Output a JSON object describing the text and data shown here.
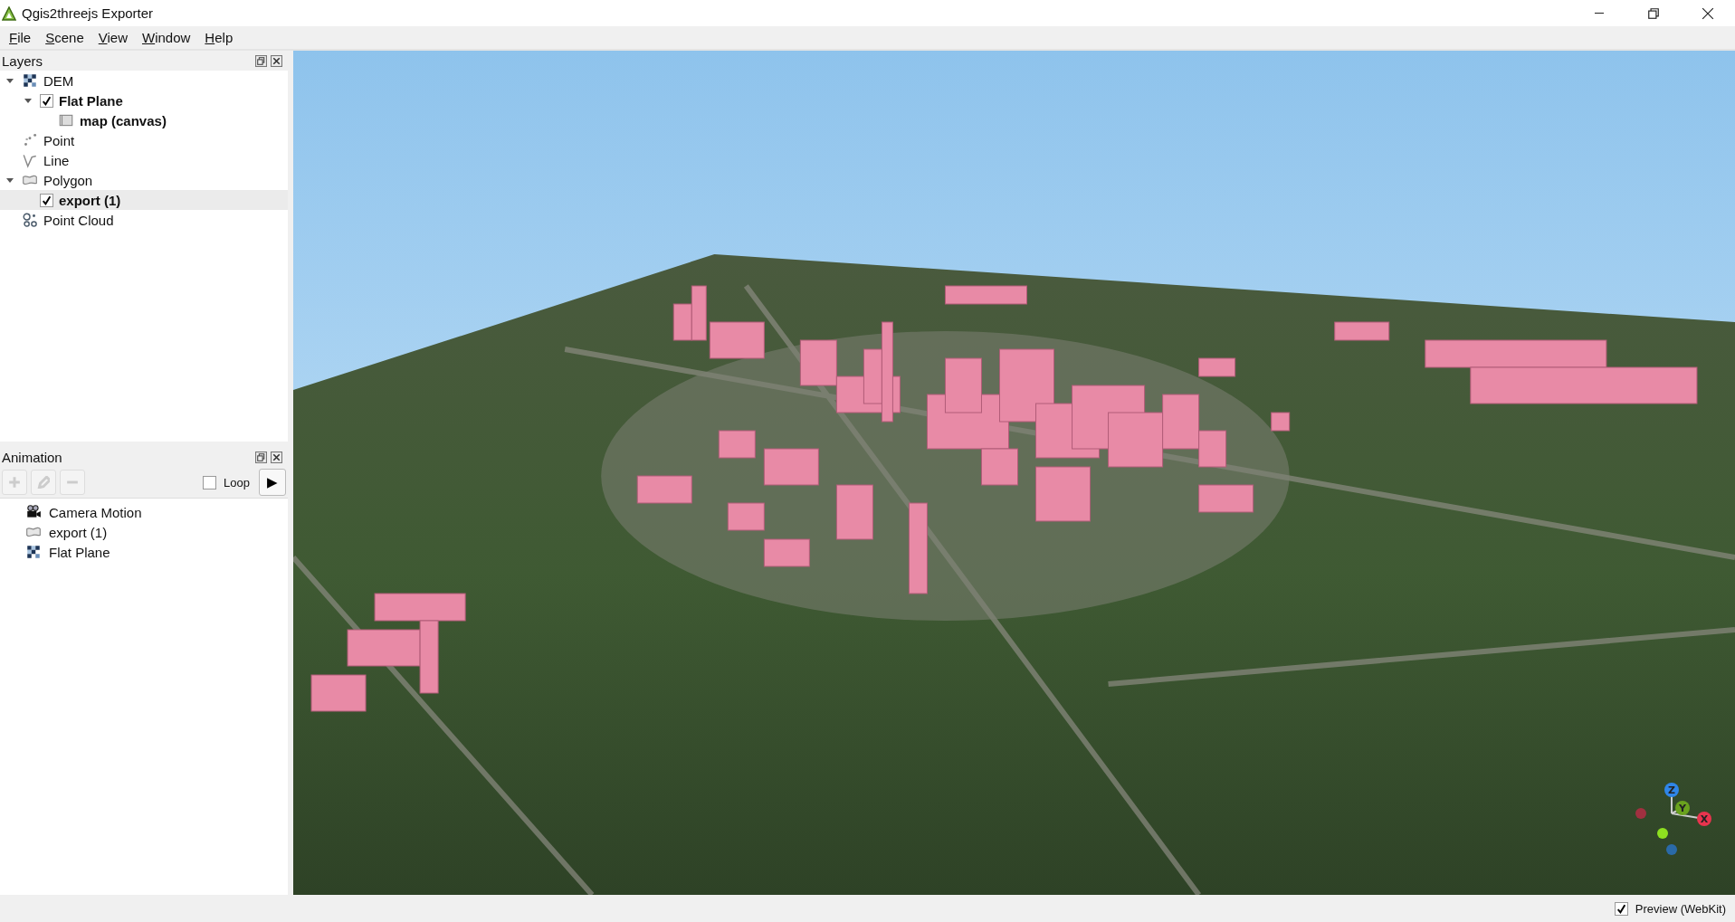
{
  "window": {
    "title": "Qgis2threejs Exporter"
  },
  "menu": [
    "File",
    "Scene",
    "View",
    "Window",
    "Help"
  ],
  "layers_panel": {
    "title": "Layers",
    "items": [
      {
        "label": "DEM",
        "kind": "dem",
        "bold": false,
        "selected": false,
        "expanded": true,
        "children": [
          {
            "label": "Flat Plane",
            "checked": true,
            "bold": true,
            "selected": false,
            "expanded": true,
            "children": [
              {
                "label": "map (canvas)",
                "kind": "map",
                "bold": true,
                "selected": false
              }
            ]
          }
        ]
      },
      {
        "label": "Point",
        "kind": "point",
        "bold": false,
        "selected": false
      },
      {
        "label": "Line",
        "kind": "line",
        "bold": false,
        "selected": false
      },
      {
        "label": "Polygon",
        "kind": "polygon",
        "bold": false,
        "selected": false,
        "expanded": true,
        "children": [
          {
            "label": "export (1)",
            "checked": true,
            "bold": true,
            "selected": true
          }
        ]
      },
      {
        "label": "Point Cloud",
        "kind": "pointcloud",
        "bold": false,
        "selected": false
      }
    ]
  },
  "animation_panel": {
    "title": "Animation",
    "tools": [
      {
        "kind": "add",
        "disabled": true
      },
      {
        "kind": "edit",
        "disabled": true
      },
      {
        "kind": "remove",
        "disabled": true
      }
    ],
    "loop": {
      "label": "Loop",
      "checked": false
    },
    "play": "▶",
    "items": [
      {
        "label": "Camera Motion",
        "kind": "camera"
      },
      {
        "label": "export (1)",
        "kind": "polygon"
      },
      {
        "label": "Flat Plane",
        "kind": "dem"
      }
    ]
  },
  "gizmo": {
    "axes": [
      {
        "label": "Z",
        "color": "#2f86e8"
      },
      {
        "label": "Y",
        "color": "#6aa21e"
      },
      {
        "label": "X",
        "color": "#e8344e"
      }
    ]
  },
  "status_bar": {
    "preview": {
      "label": "Preview (WebKit)",
      "checked": true
    }
  }
}
